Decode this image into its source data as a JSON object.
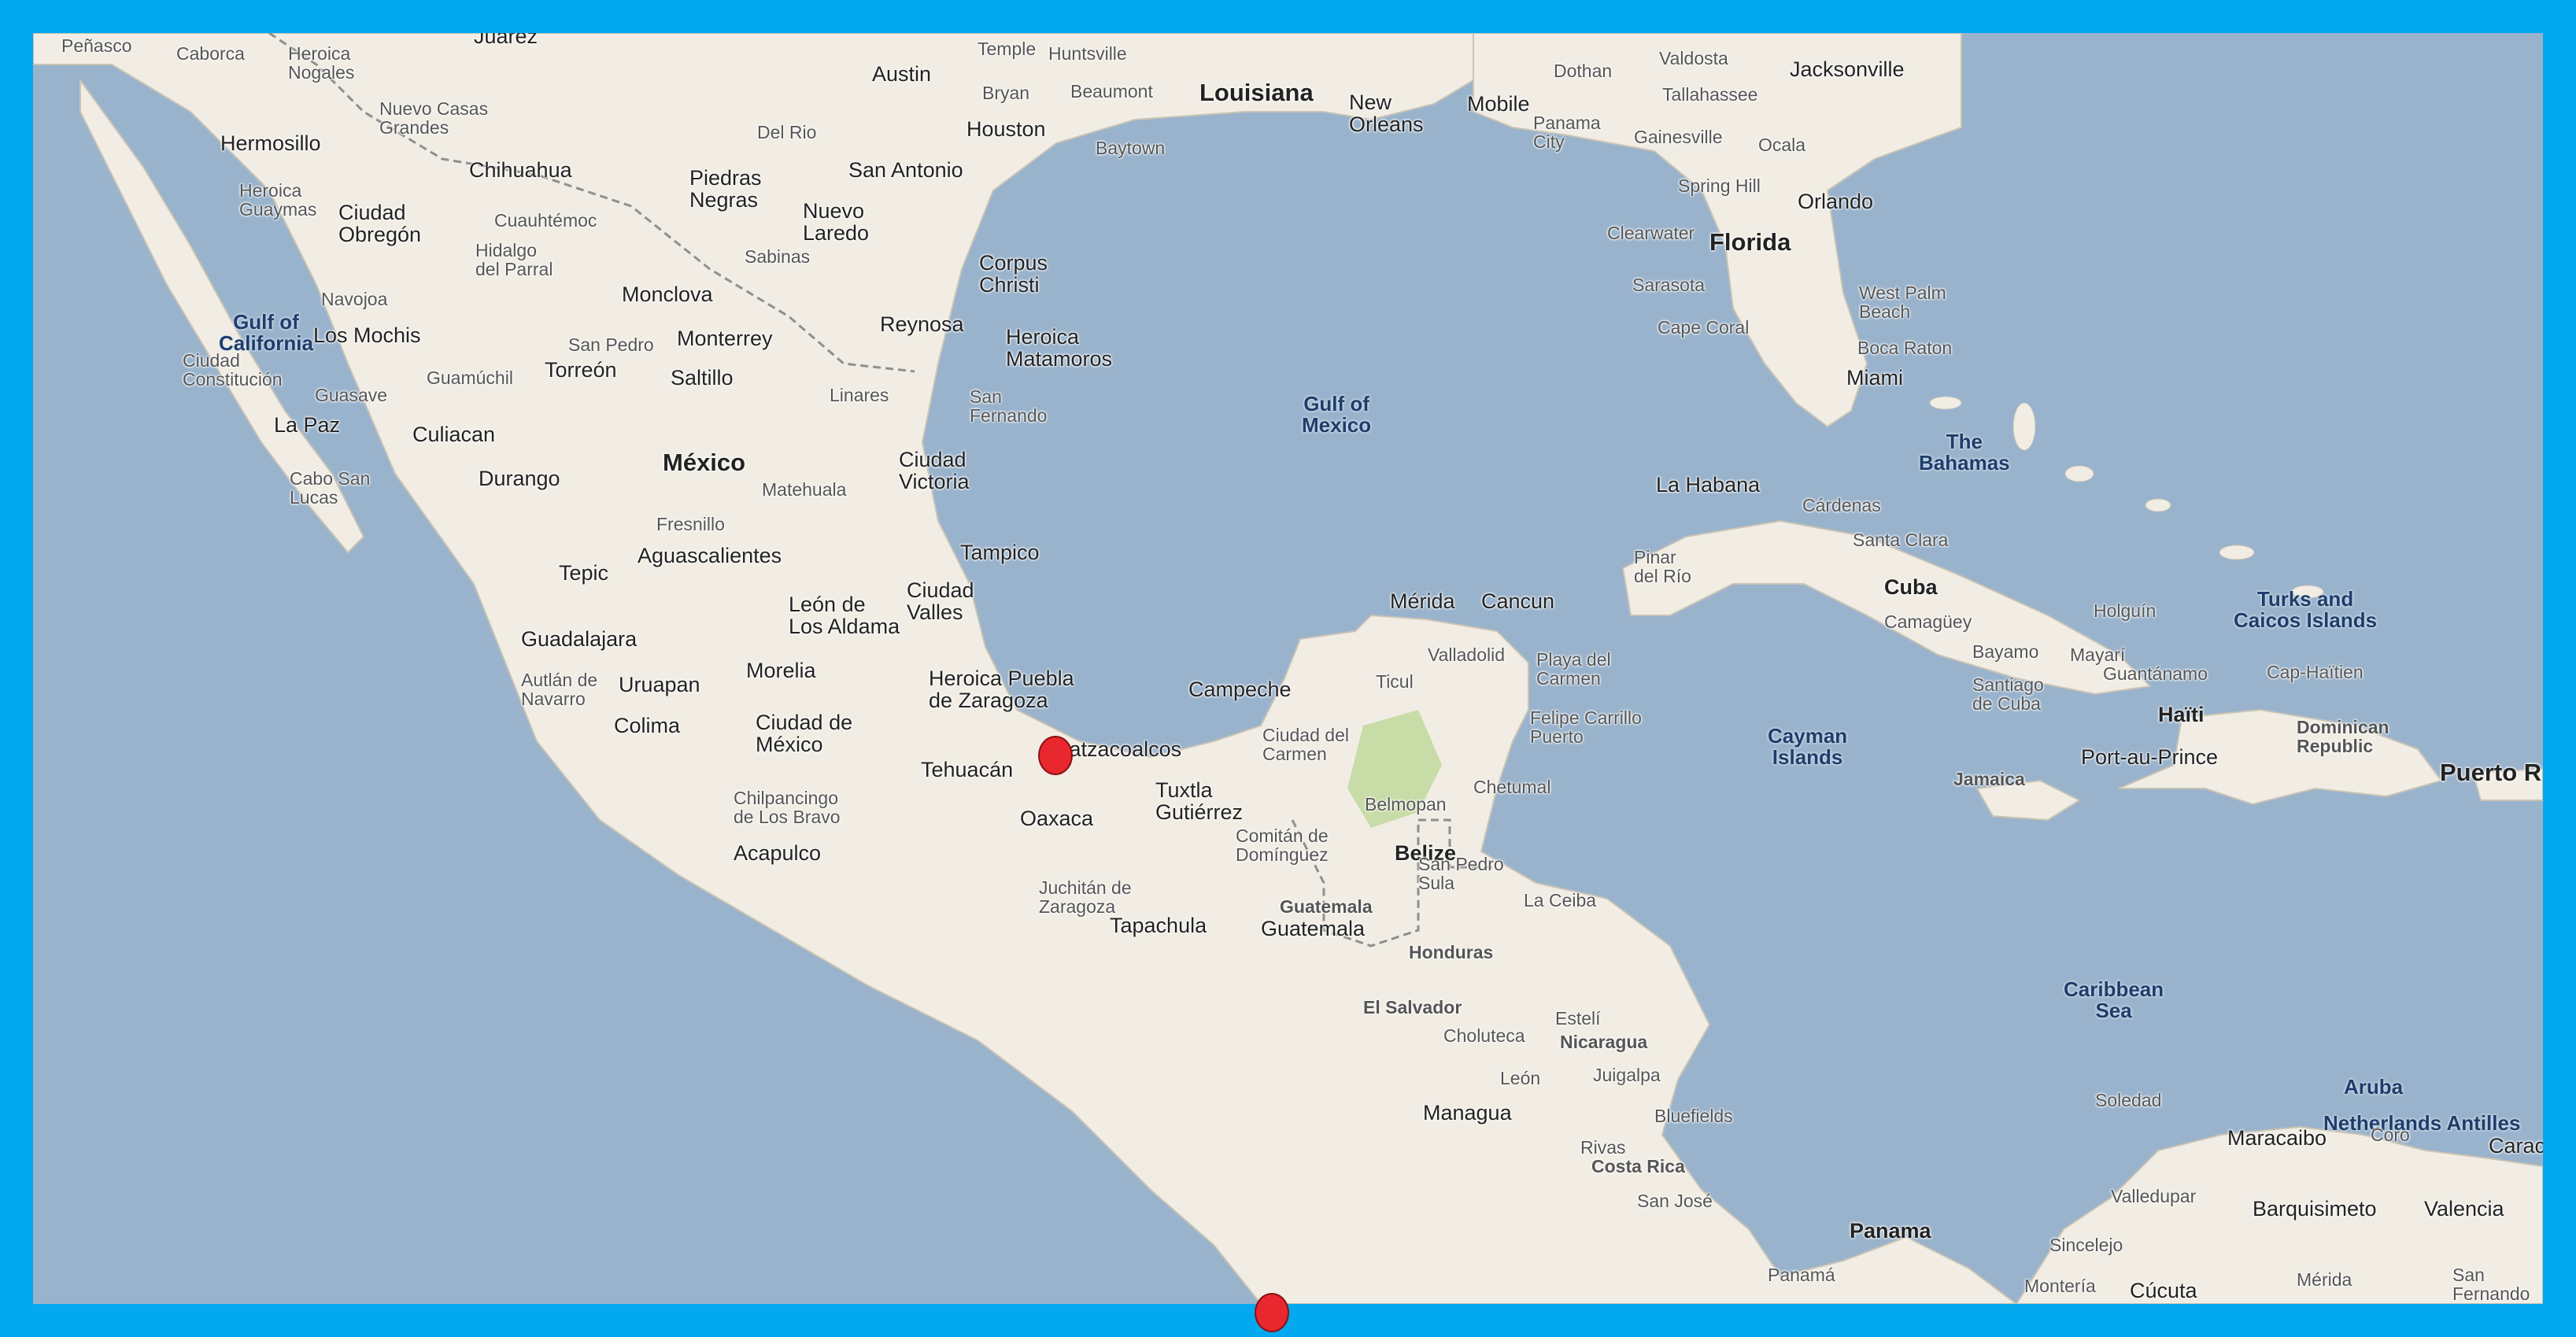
{
  "map": {
    "colors": {
      "frame": "#03a9ef",
      "water": "#99b3cc",
      "land": "#f1ede4",
      "marker": "#e8282e"
    },
    "water_labels": [
      {
        "text": "Gulf of\nCalifornia"
      },
      {
        "text": "Gulf of\nMexico"
      },
      {
        "text": "Caribbean\nSea"
      },
      {
        "text": "The\nBahamas"
      },
      {
        "text": "Cayman\nIslands"
      },
      {
        "text": "Turks and\nCaicos Islands"
      },
      {
        "text": "Aruba"
      },
      {
        "text": "Netherlands Antilles"
      }
    ],
    "regions": [
      "Louisiana",
      "Florida",
      "México",
      "Cuba",
      "Haïti",
      "Dominican\nRepublic",
      "Puerto R",
      "Belize",
      "Guatemala",
      "Honduras",
      "El Salvador",
      "Nicaragua",
      "Costa Rica",
      "Panama",
      "Jamaica"
    ],
    "cities": [
      "Peñasco",
      "Caborca",
      "Heroica\nNogales",
      "Juárez",
      "Nuevo Casas\nGrandes",
      "Hermosillo",
      "Heroica\nGuaymas",
      "Ciudad\nObregón",
      "Chihuahua",
      "Cuauhtémoc",
      "Hidalgo\ndel Parral",
      "Navojoa",
      "Los Mochis",
      "Guamúchil",
      "Ciudad\nConstitución",
      "Guasave",
      "La Paz",
      "Culiacan",
      "Cabo San\nLucas",
      "Durango",
      "Monclova",
      "San Pedro",
      "Torreón",
      "Monterrey",
      "Saltillo",
      "Piedras\nNegras",
      "Del Rio",
      "Nuevo\nLaredo",
      "Sabinas",
      "San Antonio",
      "Austin",
      "Temple",
      "Bryan",
      "Houston",
      "Huntsville",
      "Beaumont",
      "Baytown",
      "Corpus\nChristi",
      "Reynosa",
      "Heroica\nMatamoros",
      "Linares",
      "San\nFernando",
      "Ciudad\nVictoria",
      "Matehuala",
      "Fresnillo",
      "Aguascalientes",
      "Tepic",
      "Tampico",
      "Ciudad\nValles",
      "León de\nLos Aldama",
      "Guadalajara",
      "Autlán de\nNavarro",
      "Uruapan",
      "Morelia",
      "Colima",
      "Ciudad de\nMéxico",
      "Heroica Puebla\nde Zaragoza",
      "Tehuacán",
      "Coatzacoalcos",
      "Chilpancingo\nde Los Bravo",
      "Acapulco",
      "Oaxaca",
      "Juchitán de\nZaragoza",
      "Tuxtla\nGutiérrez",
      "Comitán de\nDomínguez",
      "Tapachula",
      "Campeche",
      "Mérida",
      "Valladolid",
      "Ticul",
      "Cancun",
      "Playa del\nCarmen",
      "Felipe Carrillo\nPuerto",
      "Ciudad del\nCarmen",
      "Chetumal",
      "Belmopan",
      "San Pedro\nSula",
      "La Ceiba",
      "Guatemala",
      "Choluteca",
      "Estelí",
      "Juigalpa",
      "León",
      "Managua",
      "Bluefields",
      "Rivas",
      "San José",
      "Panamá",
      "Mobile",
      "Dothan",
      "Valdosta",
      "Tallahassee",
      "Jacksonville",
      "Panama\nCity",
      "Gainesville",
      "Ocala",
      "Spring Hill",
      "Orlando",
      "Clearwater",
      "Sarasota",
      "West Palm\nBeach",
      "Boca Raton",
      "Cape Coral",
      "Miami",
      "New\nOrleans",
      "La Habana",
      "Cárdenas",
      "Pinar\ndel Río",
      "Santa Clara",
      "Camagüey",
      "Holguín",
      "Bayamo",
      "Mayarí",
      "Guantánamo",
      "Santiago\nde Cuba",
      "Cap-Haïtien",
      "Port-au-Prince",
      "Soledad",
      "Maracaibo",
      "Coro",
      "Carac",
      "Valledupar",
      "Barquisimeto",
      "Valencia",
      "Sincelejo",
      "Montería",
      "Mérida",
      "Cúcuta",
      "San\nFernando"
    ]
  }
}
